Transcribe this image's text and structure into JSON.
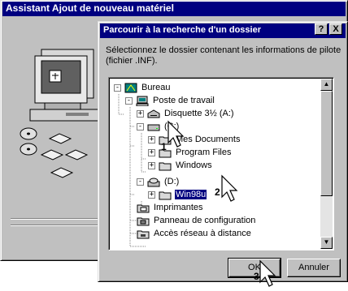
{
  "wizard": {
    "title": "Assistant Ajout de nouveau matériel"
  },
  "dialog": {
    "title": "Parcourir à la recherche d'un dossier",
    "help_label": "?",
    "close_label": "X",
    "instruction": "Sélectionnez le dossier contenant les informations de pilote (fichier .INF).",
    "tree": [
      {
        "label": "Bureau",
        "icon": "desktop-icon",
        "toggle": "-"
      },
      {
        "label": "Poste de travail",
        "icon": "computer-icon",
        "toggle": "-"
      },
      {
        "label": "Disquette 3½ (A:)",
        "icon": "floppy-drive-icon",
        "toggle": "+"
      },
      {
        "label": "(C:)",
        "icon": "hard-drive-icon",
        "toggle": "-"
      },
      {
        "label": "Mes Documents",
        "icon": "folder-icon",
        "toggle": "+"
      },
      {
        "label": "Program Files",
        "icon": "folder-icon",
        "toggle": "+"
      },
      {
        "label": "Windows",
        "icon": "folder-icon",
        "toggle": "+"
      },
      {
        "label": "(D:)",
        "icon": "cd-drive-icon",
        "toggle": "-"
      },
      {
        "label": "Win98u",
        "icon": "folder-icon",
        "toggle": "+",
        "selected": true
      },
      {
        "label": "Imprimantes",
        "icon": "printers-icon",
        "toggle": ""
      },
      {
        "label": "Panneau de configuration",
        "icon": "control-panel-icon",
        "toggle": ""
      },
      {
        "label": "Accès réseau à distance",
        "icon": "dialup-icon",
        "toggle": ""
      }
    ],
    "ok_label": "OK",
    "cancel_label": "Annuler"
  },
  "annotations": {
    "step1": "1",
    "step2": "2",
    "step3": "3"
  }
}
